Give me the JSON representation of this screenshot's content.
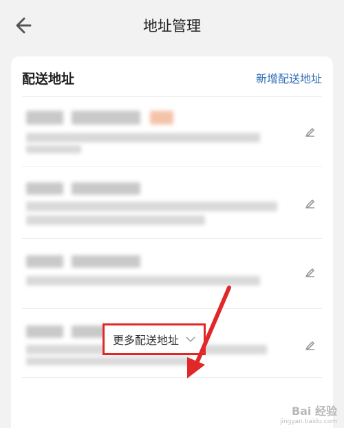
{
  "header": {
    "title": "地址管理",
    "back_icon": "back-arrow-icon"
  },
  "card": {
    "title": "配送地址",
    "add_label": "新增配送地址",
    "add_color": "#2f6eb6",
    "items": [
      {
        "edit_icon": "pencil-icon"
      },
      {
        "edit_icon": "pencil-icon"
      },
      {
        "edit_icon": "pencil-icon"
      },
      {
        "edit_icon": "pencil-icon"
      }
    ]
  },
  "footer": {
    "more_label": "更多配送地址",
    "chevron_icon": "chevron-down-icon",
    "highlight_color": "#e12828"
  },
  "watermark": {
    "main": "Bai 经验",
    "sub": "jingyan.baidu.com"
  }
}
